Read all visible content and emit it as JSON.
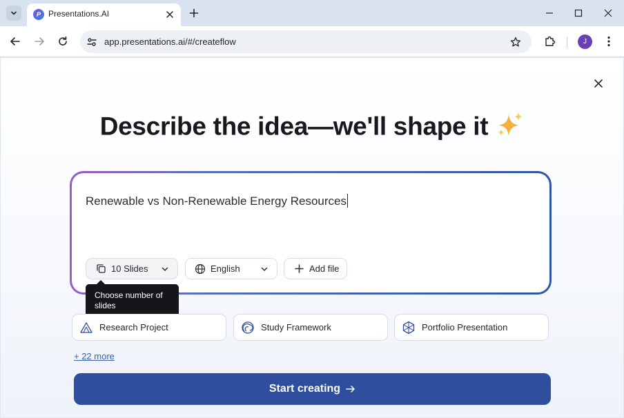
{
  "browser": {
    "tab": {
      "title": "Presentations.AI",
      "favicon_letter": "P"
    },
    "omnibox": {
      "url": "app.presentations.ai/#/createflow"
    },
    "profile": {
      "initial": "J",
      "color": "#6a3fb8"
    },
    "icons": {
      "tab_search": "chevron-down-icon",
      "tab_close": "close-icon",
      "new_tab": "plus-icon",
      "minimize": "minimize-icon",
      "maximize": "maximize-icon",
      "window_close": "close-icon",
      "back": "arrow-left-icon",
      "forward": "arrow-right-icon",
      "reload": "reload-icon",
      "site_info": "tune-icon",
      "bookmark": "star-icon",
      "extensions": "puzzle-icon",
      "menu": "kebab-menu-icon"
    }
  },
  "page": {
    "headline": "Describe the idea—we'll shape it",
    "headline_emoji": "sparkles-icon",
    "prompt": {
      "value": "Renewable vs Non-Renewable Energy Resources"
    },
    "options": {
      "slides": {
        "label": "10 Slides",
        "icon": "copy-icon"
      },
      "language": {
        "label": "English",
        "icon": "globe-icon"
      },
      "add_file": {
        "label": "Add file",
        "icon": "plus-icon"
      }
    },
    "tooltip": "Choose number of slides",
    "suggestions": [
      {
        "label": "Research Project",
        "icon": "triangle-icon"
      },
      {
        "label": "Study Framework",
        "icon": "spiral-icon"
      },
      {
        "label": "Portfolio Presentation",
        "icon": "cube-icon"
      }
    ],
    "more_link": "+ 22 more",
    "cta": {
      "label": "Start creating",
      "icon": "arrow-right-icon"
    },
    "colors": {
      "cta": "#2f4f9e",
      "link": "#3a5fb0",
      "gradient_start": "#9a5cc6",
      "gradient_end": "#2f55a8"
    }
  }
}
